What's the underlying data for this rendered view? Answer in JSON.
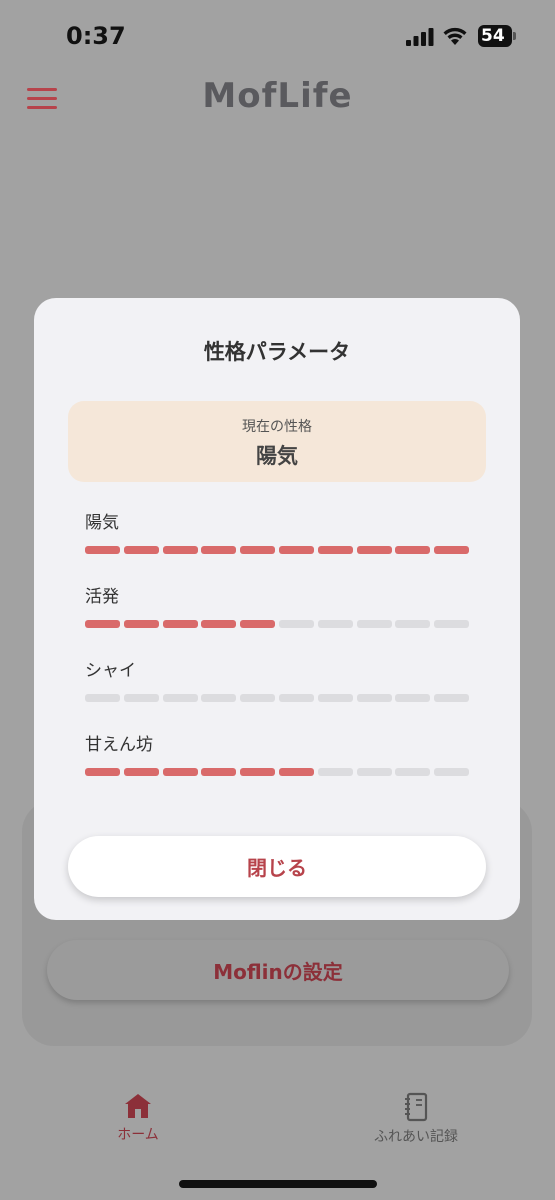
{
  "status_bar": {
    "time": "0:37",
    "battery": "54"
  },
  "header": {
    "app_name": "MofLife",
    "menu_icon": "hamburger-menu-icon"
  },
  "background": {
    "settings_button_label": "Moflinの設定"
  },
  "nav": {
    "items": [
      {
        "label": "ホーム",
        "icon": "home-icon",
        "active": true
      },
      {
        "label": "ふれあい記録",
        "icon": "notebook-icon",
        "active": false
      }
    ]
  },
  "modal": {
    "title": "性格パラメータ",
    "current": {
      "label": "現在の性格",
      "value": "陽気"
    },
    "segments_total": 10,
    "parameters": [
      {
        "label": "陽気",
        "level": 10
      },
      {
        "label": "活発",
        "level": 5
      },
      {
        "label": "シャイ",
        "level": 0
      },
      {
        "label": "甘えん坊",
        "level": 6
      }
    ],
    "close_label": "閉じる"
  },
  "colors": {
    "accent": "#b7434b",
    "bar_on": "#d96a6a",
    "bar_off": "#dcdcdf",
    "current_box": "#f5e7d9"
  }
}
